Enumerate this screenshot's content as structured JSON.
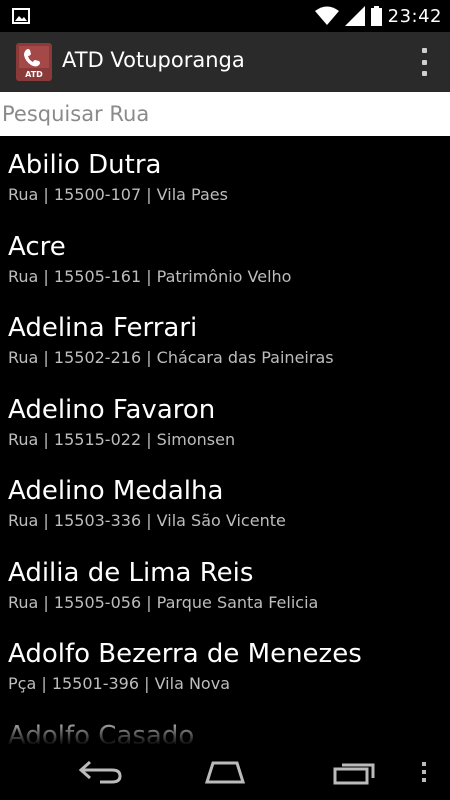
{
  "status_bar": {
    "time": "23:42",
    "icons": [
      "picture-icon",
      "wifi-icon",
      "signal-icon",
      "battery-icon"
    ]
  },
  "action_bar": {
    "title": "ATD Votuporanga",
    "app_icon_text": "ATD",
    "overflow_icon": "overflow-menu-icon"
  },
  "search": {
    "placeholder": "Pesquisar Rua",
    "value": ""
  },
  "streets": [
    {
      "name": "Abilio Dutra",
      "detail": "Rua | 15500-107 | Vila Paes"
    },
    {
      "name": "Acre",
      "detail": "Rua | 15505-161 | Patrimônio Velho"
    },
    {
      "name": "Adelina Ferrari",
      "detail": "Rua | 15502-216 | Chácara das Paineiras"
    },
    {
      "name": "Adelino Favaron",
      "detail": "Rua | 15515-022 | Simonsen"
    },
    {
      "name": "Adelino Medalha",
      "detail": "Rua | 15503-336 | Vila São Vicente"
    },
    {
      "name": "Adilia de Lima Reis",
      "detail": "Rua | 15505-056 | Parque Santa Felicia"
    },
    {
      "name": "Adolfo Bezerra de Menezes",
      "detail": "Pça | 15501-396 | Vila Nova"
    },
    {
      "name": "Adolfo Casado",
      "detail": ""
    }
  ],
  "nav_bar": {
    "icons": [
      "back-icon",
      "home-icon",
      "recent-apps-icon",
      "menu-icon"
    ]
  },
  "colors": {
    "background": "#000000",
    "action_bar": "#2a2a2a",
    "subtitle": "#bdbdbd",
    "app_icon": "#8b3a3a"
  }
}
